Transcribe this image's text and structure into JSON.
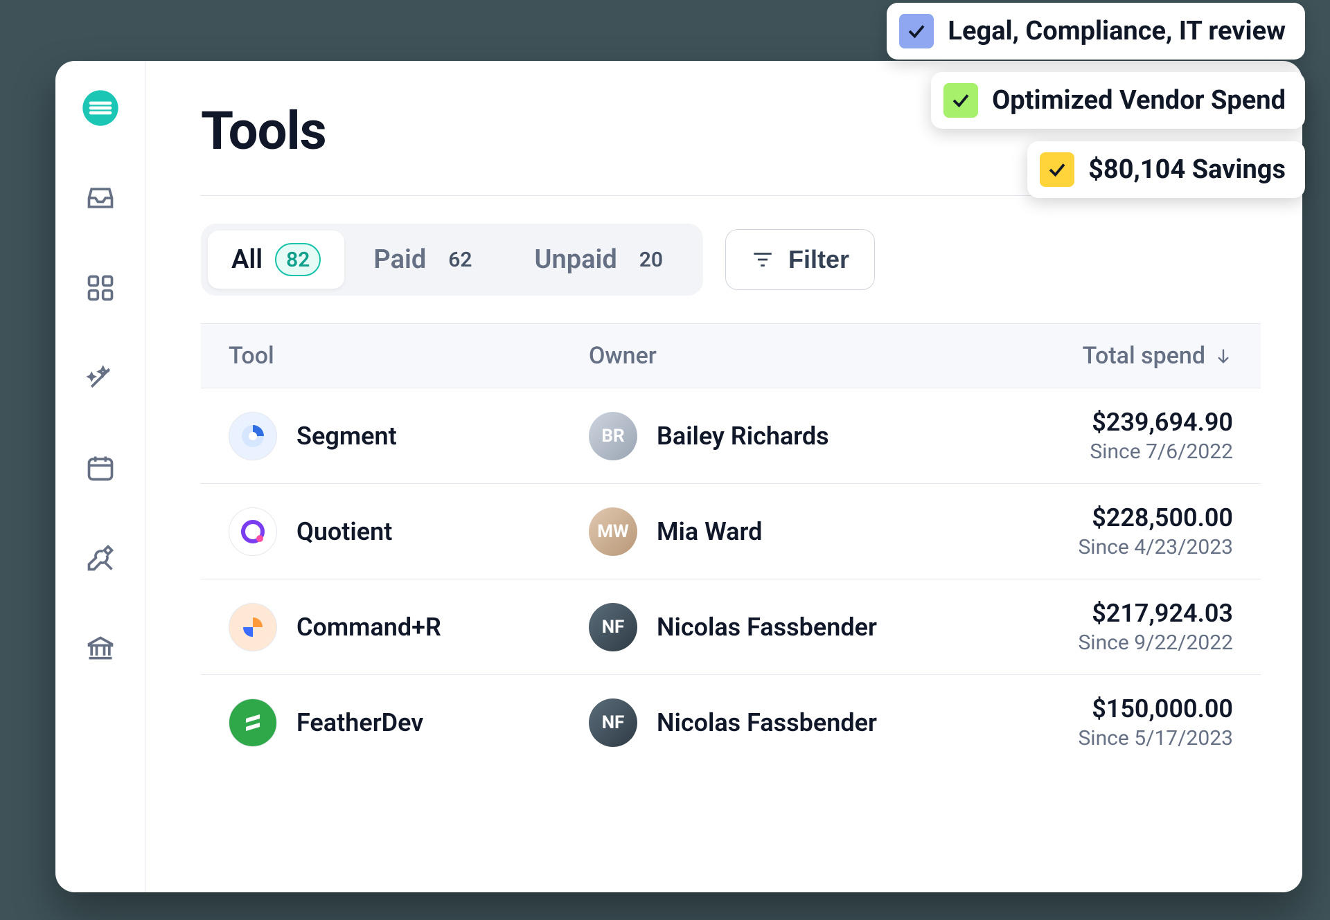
{
  "page": {
    "title": "Tools"
  },
  "tabs": {
    "all": {
      "label": "All",
      "count": "82"
    },
    "paid": {
      "label": "Paid",
      "count": "62"
    },
    "unpaid": {
      "label": "Unpaid",
      "count": "20"
    }
  },
  "filter": {
    "label": "Filter"
  },
  "columns": {
    "tool": "Tool",
    "owner": "Owner",
    "spend": "Total spend"
  },
  "rows": [
    {
      "tool": "Segment",
      "owner": "Bailey Richards",
      "amount": "$239,694.90",
      "since": "Since 7/6/2022"
    },
    {
      "tool": "Quotient",
      "owner": "Mia Ward",
      "amount": "$228,500.00",
      "since": "Since 4/23/2023"
    },
    {
      "tool": "Command+R",
      "owner": "Nicolas Fassbender",
      "amount": "$217,924.03",
      "since": "Since 9/22/2022"
    },
    {
      "tool": "FeatherDev",
      "owner": "Nicolas Fassbender",
      "amount": "$150,000.00",
      "since": "Since 5/17/2023"
    }
  ],
  "callouts": [
    {
      "color": "blue",
      "text": "Legal, Compliance, IT review"
    },
    {
      "color": "green",
      "text": "Optimized Vendor Spend"
    },
    {
      "color": "yellow",
      "text": "$80,104 Savings"
    }
  ]
}
